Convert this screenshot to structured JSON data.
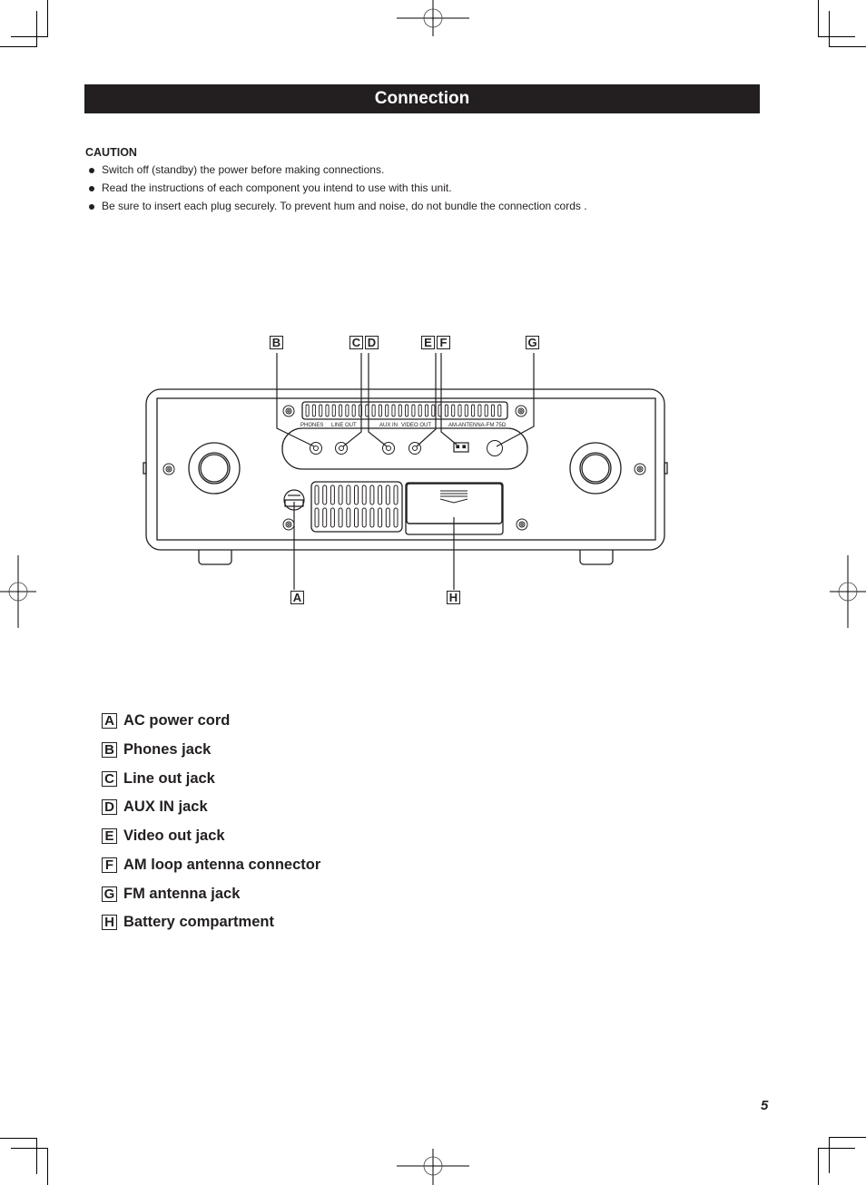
{
  "header": {
    "title": "Connection"
  },
  "caution": {
    "title": "CAUTION",
    "items": [
      "Switch off (standby) the power before making connections.",
      "Read the instructions of each component you intend to use with this unit.",
      "Be sure to insert each plug securely. To prevent hum and noise, do not bundle the connection cords ."
    ]
  },
  "diagram": {
    "callouts_top": [
      "B",
      "C",
      "D",
      "E",
      "F",
      "G"
    ],
    "callouts_bottom": [
      "A",
      "H"
    ],
    "panel_labels": {
      "phones": "PHONES",
      "line_out": "LINE OUT",
      "aux_in": "AUX IN",
      "video_out": "VIDEO OUT",
      "antenna": "AM-ANTENNA-FM 75Ω"
    }
  },
  "legend": [
    {
      "key": "A",
      "label": "AC power cord"
    },
    {
      "key": "B",
      "label": "Phones jack"
    },
    {
      "key": "C",
      "label": "Line out jack"
    },
    {
      "key": "D",
      "label": "AUX IN jack"
    },
    {
      "key": "E",
      "label": "Video out jack"
    },
    {
      "key": "F",
      "label": "AM loop antenna connector"
    },
    {
      "key": "G",
      "label": "FM antenna jack"
    },
    {
      "key": "H",
      "label": "Battery compartment"
    }
  ],
  "footer": {
    "page_number": "5"
  }
}
